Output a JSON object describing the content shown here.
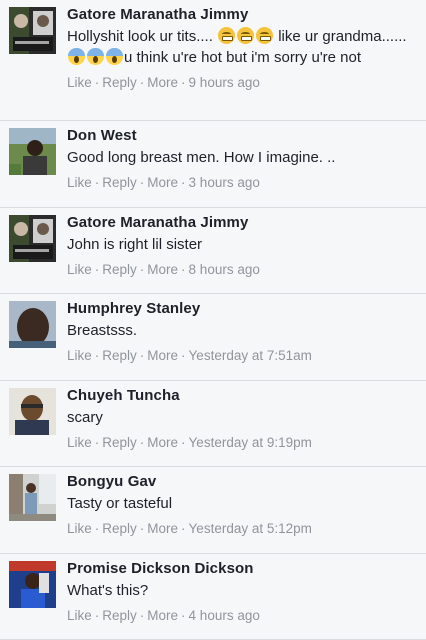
{
  "comments": [
    {
      "name": "Gatore Maranatha Jimmy",
      "text_before": "Hollyshit look ur tits.... ",
      "text_mid": " like ur grandma...... ",
      "text_after": "u think u're hot but i'm sorry u're not",
      "actions": {
        "like": "Like",
        "reply": "Reply",
        "more": "More"
      },
      "separator": "·",
      "time": "9 hours ago",
      "avatar_icon": "profile-photo",
      "emojis_1": "grinning-face",
      "emojis_2": "screaming-face"
    },
    {
      "name": "Don West",
      "text": "Good long breast men. How I imagine. ..",
      "actions": {
        "like": "Like",
        "reply": "Reply",
        "more": "More"
      },
      "separator": "·",
      "time": "3 hours ago",
      "avatar_icon": "profile-photo"
    },
    {
      "name": "Gatore Maranatha Jimmy",
      "text": "John is right lil sister",
      "actions": {
        "like": "Like",
        "reply": "Reply",
        "more": "More"
      },
      "separator": "·",
      "time": "8 hours ago",
      "avatar_icon": "profile-photo"
    },
    {
      "name": "Humphrey Stanley",
      "text": "Breastsss.",
      "actions": {
        "like": "Like",
        "reply": "Reply",
        "more": "More"
      },
      "separator": "·",
      "time": "Yesterday at 7:51am",
      "avatar_icon": "profile-photo"
    },
    {
      "name": "Chuyeh Tuncha",
      "text": "scary",
      "actions": {
        "like": "Like",
        "reply": "Reply",
        "more": "More"
      },
      "separator": "·",
      "time": "Yesterday at 9:19pm",
      "avatar_icon": "profile-photo"
    },
    {
      "name": "Bongyu Gav",
      "text": "Tasty or tasteful",
      "actions": {
        "like": "Like",
        "reply": "Reply",
        "more": "More"
      },
      "separator": "·",
      "time": "Yesterday at 5:12pm",
      "avatar_icon": "profile-photo"
    },
    {
      "name": "Promise Dickson Dickson",
      "text": "What's this?",
      "actions": {
        "like": "Like",
        "reply": "Reply",
        "more": "More"
      },
      "separator": "·",
      "time": "4 hours ago",
      "avatar_icon": "profile-photo"
    }
  ],
  "colors": {
    "background": "#f6f7f9",
    "text": "#1d2129",
    "meta": "#90949c",
    "divider": "#d9dce1"
  }
}
